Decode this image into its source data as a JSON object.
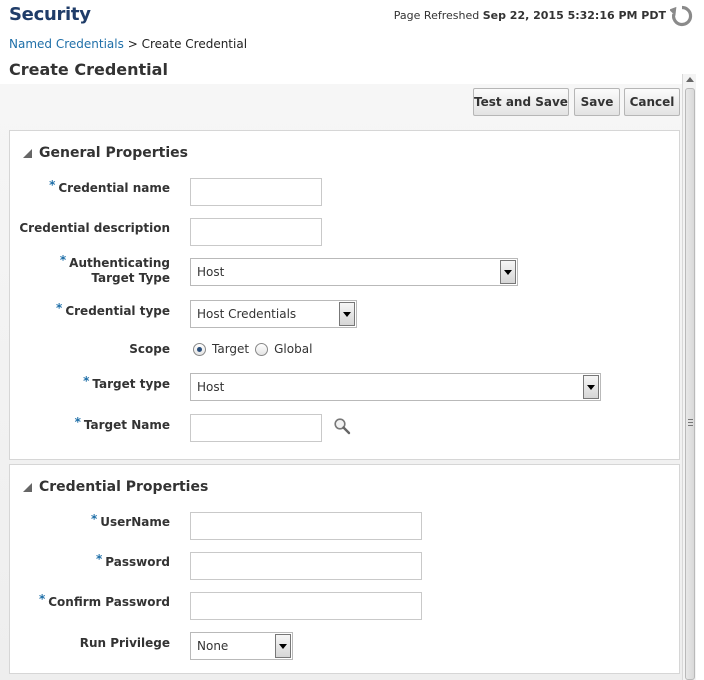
{
  "app": {
    "title": "Security"
  },
  "refresh": {
    "label": "Page Refreshed",
    "timestamp": "Sep 22, 2015 5:32:16 PM PDT"
  },
  "breadcrumb": {
    "parent": "Named Credentials",
    "separator": ">",
    "current": "Create Credential"
  },
  "page": {
    "title": "Create Credential"
  },
  "toolbar": {
    "test_save_label": "Test and Save",
    "save_label": "Save",
    "cancel_label": "Cancel"
  },
  "general": {
    "header": "General Properties",
    "credential_name_label": "Credential name",
    "credential_name_value": "",
    "credential_description_label": "Credential description",
    "credential_description_value": "",
    "auth_target_type_label": "Authenticating Target Type",
    "auth_target_type_value": "Host",
    "credential_type_label": "Credential type",
    "credential_type_value": "Host Credentials",
    "scope_label": "Scope",
    "scope_target": "Target",
    "scope_global": "Global",
    "scope_selected": "Target",
    "target_type_label": "Target type",
    "target_type_value": "Host",
    "target_name_label": "Target Name",
    "target_name_value": ""
  },
  "credential_props": {
    "header": "Credential Properties",
    "username_label": "UserName",
    "password_label": "Password",
    "confirm_password_label": "Confirm Password",
    "run_privilege_label": "Run Privilege",
    "run_privilege_value": "None"
  },
  "required_marker": "*",
  "icons": {
    "refresh": "refresh-icon",
    "search": "search-icon",
    "collapse": "collapse-triangle-icon",
    "dropdown": "chevron-down-icon"
  },
  "colors": {
    "title": "#1f3c68",
    "link": "#1f6fa8",
    "required": "#1f6fa8"
  }
}
